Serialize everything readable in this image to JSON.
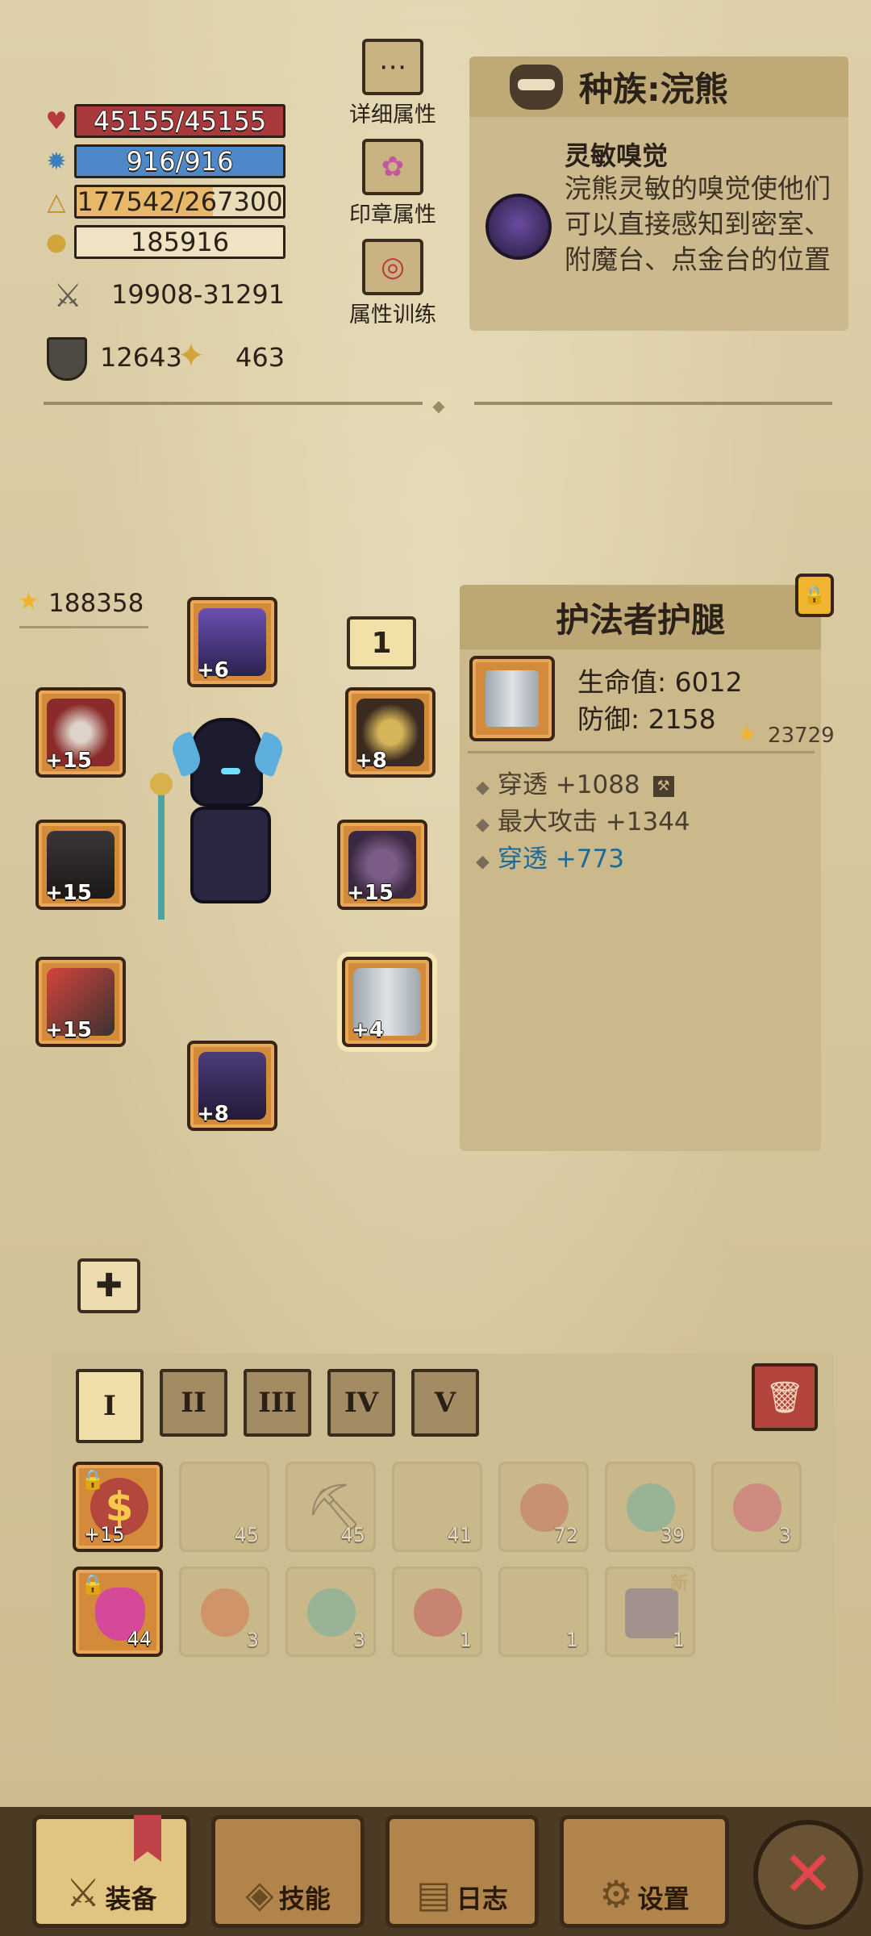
{
  "stats": {
    "hp": "45155/45155",
    "mp": "916/916",
    "exp": "177542/267300",
    "gold": "185916",
    "attack": "19908-31291",
    "defense": "12643",
    "power": "463"
  },
  "side_buttons": {
    "detail": "详细属性",
    "seal": "印章属性",
    "train": "属性训练"
  },
  "race": {
    "title": "种族:浣熊",
    "skill_name": "灵敏嗅觉",
    "skill_desc": "浣熊灵敏的嗅觉使他们可以直接感知到密室、附魔台、点金台的位置"
  },
  "equipment": {
    "score": "188358",
    "page_badge": "1",
    "slots": [
      {
        "name": "helmet",
        "level": "+6"
      },
      {
        "name": "weapon-left",
        "level": "+15"
      },
      {
        "name": "armor-left",
        "level": "+15"
      },
      {
        "name": "gloves-left",
        "level": "+15"
      },
      {
        "name": "boots",
        "level": "+8"
      },
      {
        "name": "necklace",
        "level": "+8"
      },
      {
        "name": "horns",
        "level": "+15"
      },
      {
        "name": "leggings",
        "level": "+4"
      }
    ]
  },
  "item": {
    "title": "护法者护腿",
    "hp_label": "生命值: 6012",
    "def_label": "防御: 2158",
    "score": "23729",
    "props": [
      {
        "text": "穿透 +1088"
      },
      {
        "text": "最大攻击 +1344"
      },
      {
        "text": "穿透 +773"
      }
    ]
  },
  "bag": {
    "tabs": [
      "I",
      "II",
      "III",
      "IV",
      "V"
    ],
    "row1": [
      {
        "count": "+15",
        "locked": true
      },
      {
        "count": "45"
      },
      {
        "count": "45"
      },
      {
        "count": "41"
      },
      {
        "count": "72"
      },
      {
        "count": "39"
      },
      {
        "count": "3"
      }
    ],
    "row2": [
      {
        "count": "44",
        "locked": true
      },
      {
        "count": "3"
      },
      {
        "count": "3"
      },
      {
        "count": "1"
      },
      {
        "count": "1"
      },
      {
        "count": "1",
        "badge": "新"
      }
    ]
  },
  "nav": {
    "equip": "装备",
    "skill": "技能",
    "log": "日志",
    "settings": "设置"
  },
  "colors": {
    "hp": "#a9393c",
    "mp": "#4d88c9",
    "exp": "#e7b86a",
    "close": "#e2454a",
    "prop_blue": "#1d6a96"
  }
}
